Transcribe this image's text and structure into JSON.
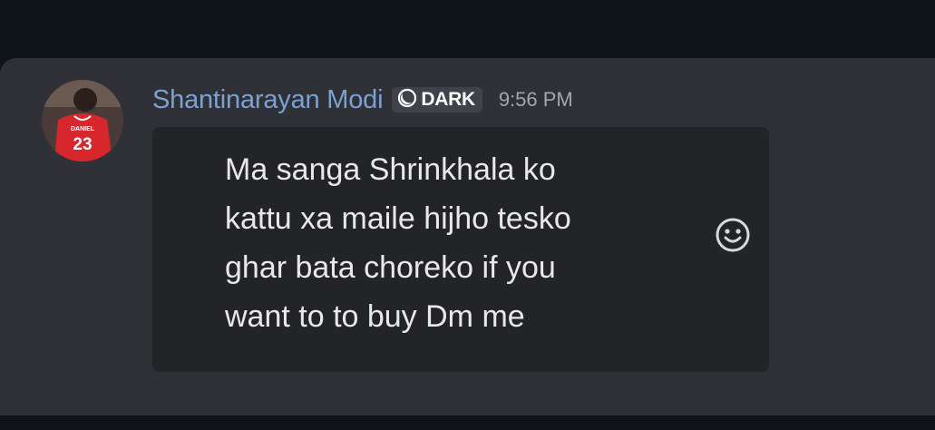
{
  "message": {
    "author": "Shantinarayan Modi",
    "badge": {
      "icon": "moon-icon",
      "label": "DARK"
    },
    "timestamp": "9:56 PM",
    "lines": [
      "Ma sanga Shrinkhala ko",
      "kattu xa maile hijho tesko",
      "ghar bata choreko if you",
      "want to to buy Dm me"
    ],
    "avatar": {
      "jersey_name": "DANIEL",
      "jersey_number": "23",
      "jersey_color": "#d7262c"
    }
  },
  "reaction_button": {
    "icon": "smiley-icon"
  },
  "colors": {
    "username": "#7aa1d2",
    "panel": "#2f3136",
    "card": "#232428",
    "text": "#e8e8e8",
    "timestamp": "#a3a6aa"
  }
}
